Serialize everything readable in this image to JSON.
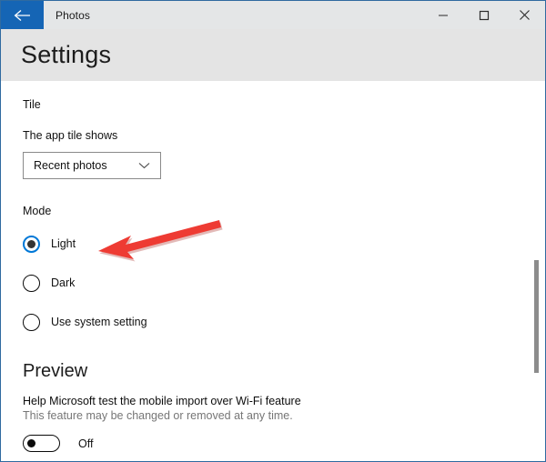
{
  "window": {
    "app_title": "Photos",
    "border_color": "#2f6aa0",
    "back_icon": "back-arrow-icon",
    "back_button_color": "#1565b5",
    "controls": [
      {
        "name": "minimize",
        "icon": "minimize-icon"
      },
      {
        "name": "maximize",
        "icon": "maximize-icon"
      },
      {
        "name": "close",
        "icon": "close-icon"
      }
    ]
  },
  "header": {
    "title": "Settings",
    "band_color": "#e4e4e4"
  },
  "tile_section": {
    "group_label": "Tile",
    "field_label": "The app tile shows",
    "dropdown": {
      "value": "Recent photos",
      "chevron_icon": "chevron-down-icon"
    }
  },
  "mode_section": {
    "group_label": "Mode",
    "selected": "Light",
    "options": [
      {
        "label": "Light",
        "checked": true
      },
      {
        "label": "Dark",
        "checked": false
      },
      {
        "label": "Use system setting",
        "checked": false
      }
    ],
    "accent_color": "#0078d7"
  },
  "preview_section": {
    "title": "Preview",
    "description_primary": "Help Microsoft test the mobile import over Wi-Fi feature",
    "description_secondary": "This feature may be changed or removed at any time.",
    "toggle": {
      "state_label": "Off",
      "on": false
    }
  },
  "annotation": {
    "type": "arrow",
    "color": "#ee3b33",
    "points_to": "Light radio option"
  },
  "scrollbar": {
    "orientation": "vertical",
    "thumb_color": "#8c8c8c"
  }
}
